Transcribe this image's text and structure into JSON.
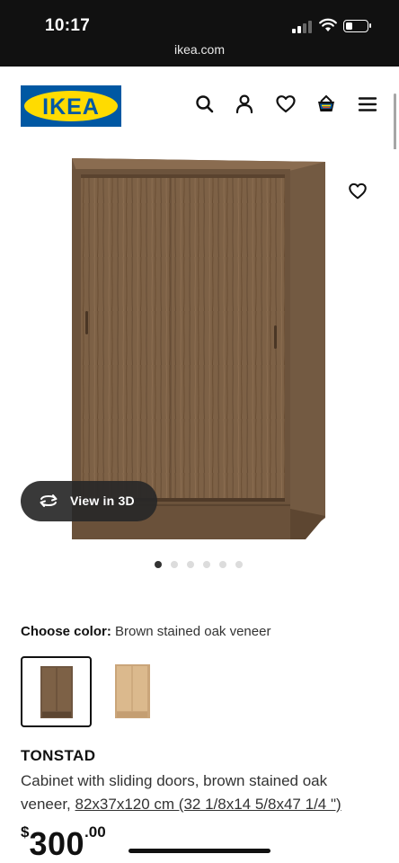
{
  "status_bar": {
    "time": "10:17",
    "url": "ikea.com",
    "battery_percent": 25
  },
  "header": {
    "logo_text": "IKEA",
    "icons": [
      "search-icon",
      "account-icon",
      "favorites-icon",
      "cart-icon",
      "menu-icon"
    ]
  },
  "gallery": {
    "view_3d_label": "View in 3D",
    "image_count": 6,
    "active_image": 1
  },
  "color_selector": {
    "label": "Choose color:",
    "selected_value": "Brown stained oak veneer",
    "options": [
      "brown-stained-oak-swatch",
      "white-stained-oak-swatch"
    ]
  },
  "product": {
    "name": "TONSTAD",
    "description": "Cabinet with sliding doors, brown stained oak veneer,",
    "size_link": "82x37x120 cm (32 1/8x14 5/8x47 1/4 \")",
    "price_currency": "$",
    "price_main": "300",
    "price_decimals": ".00"
  },
  "colors": {
    "ikea_blue": "#0058a3",
    "ikea_yellow": "#ffdb00",
    "brown_oak": "#7a6045",
    "light_oak": "#d8b68a"
  }
}
